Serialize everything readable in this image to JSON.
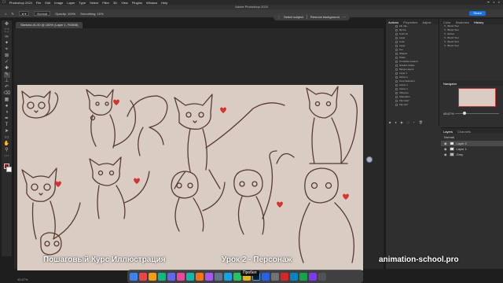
{
  "menubar": {
    "app_name": "Photoshop 2024",
    "items": [
      "File",
      "Edit",
      "Image",
      "Layer",
      "Type",
      "Select",
      "Filter",
      "3D",
      "View",
      "Plugins",
      "Window",
      "Help"
    ],
    "right_items": [
      "ᯤ",
      "◐",
      "⌕"
    ]
  },
  "title": "Adobe Photoshop 2024",
  "options": {
    "mode_label": "Normal",
    "opacity_label": "Opacity: 100%",
    "flow_label": "Smoothing: 10%",
    "share_label": "Share"
  },
  "document_tab": "Sketchа #1.00 @ 100% (Layer 1, RGB/8)",
  "context_bar": {
    "select_subject": "Select subject",
    "remove_background": "Remove background"
  },
  "panels": {
    "actions_tabs": [
      "Actions",
      "Properties",
      "Adjust"
    ],
    "history_tabs": [
      "Color",
      "Swatches",
      "History"
    ],
    "navigator_label": "Navigator",
    "zoom": "45.67%",
    "layers_tabs": [
      "Layers",
      "Channels"
    ],
    "blend_mode": "Normal",
    "actions": [
      "Ink rule",
      "flip ink",
      "Color kit",
      "Layer",
      "Color",
      "Layer",
      "Cut",
      "Shapes",
      "Paste",
      "Complete expand",
      "shadow dodge",
      "Merge Layers",
      "Layer 1",
      "Action 1",
      "Crop Selection",
      "Action 1",
      "Action 1",
      "Vibrance",
      "Saturation",
      "Flip Horiz",
      "Flip Vert"
    ],
    "history_items": [
      "Brush Tool",
      "Brush Tool",
      "Eraser",
      "Brush Tool",
      "Brush Tool",
      "Brush Tool"
    ],
    "layers": [
      {
        "name": "Layer 2"
      },
      {
        "name": "Layer 1"
      },
      {
        "name": "Grey"
      }
    ]
  },
  "status": "45.67%",
  "space_chip": "Пробел",
  "captions": {
    "left": "Пошаговый Курс Иллюстрация",
    "middle": "Урок 2 - Персонаж",
    "right": "animation-school.pro"
  },
  "colors": {
    "accent": "#1473e6",
    "canvas": "#d9cdc3",
    "ink": "#5a3a30",
    "heart": "#d9322e"
  }
}
